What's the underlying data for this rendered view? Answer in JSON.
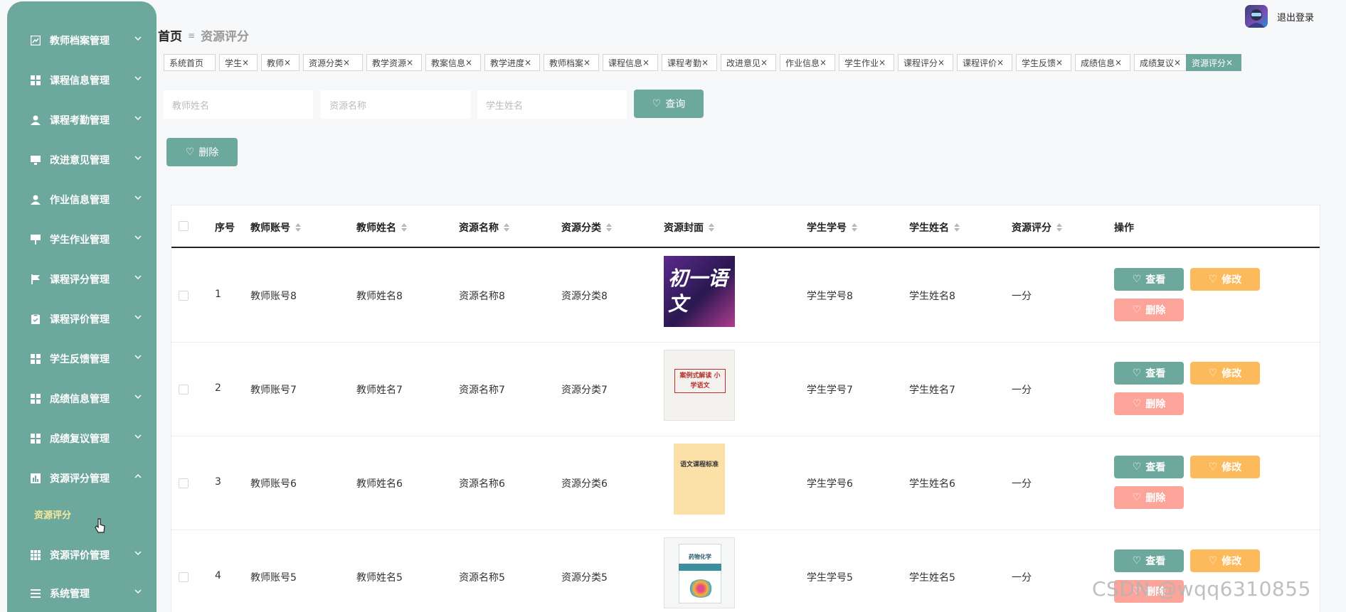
{
  "sidebar": {
    "items": [
      {
        "label": "教师档案管理",
        "icon": "chart-icon"
      },
      {
        "label": "课程信息管理",
        "icon": "grid-icon"
      },
      {
        "label": "课程考勤管理",
        "icon": "user-icon"
      },
      {
        "label": "改进意见管理",
        "icon": "monitor-icon"
      },
      {
        "label": "作业信息管理",
        "icon": "user-icon"
      },
      {
        "label": "学生作业管理",
        "icon": "board-icon"
      },
      {
        "label": "课程评分管理",
        "icon": "flag-icon"
      },
      {
        "label": "课程评价管理",
        "icon": "clipboard-icon"
      },
      {
        "label": "学生反馈管理",
        "icon": "grid-icon"
      },
      {
        "label": "成绩信息管理",
        "icon": "grid-icon"
      },
      {
        "label": "成绩复议管理",
        "icon": "grid-icon"
      },
      {
        "label": "资源评分管理",
        "icon": "bar-chart-icon",
        "expanded": true
      },
      {
        "label": "资源评价管理",
        "icon": "grid-icon"
      },
      {
        "label": "系统管理",
        "icon": "list-icon"
      }
    ],
    "sub_item": "资源评分"
  },
  "header": {
    "logout": "退出登录"
  },
  "breadcrumb": {
    "home": "首页",
    "separator": "≡",
    "current": "资源评分"
  },
  "tags": [
    {
      "label": "系统首页",
      "closable": false
    },
    {
      "label": "学生",
      "closable": true
    },
    {
      "label": "教师",
      "closable": true
    },
    {
      "label": "资源分类",
      "closable": true
    },
    {
      "label": "教学资源",
      "closable": true
    },
    {
      "label": "教案信息",
      "closable": true
    },
    {
      "label": "教学进度",
      "closable": true
    },
    {
      "label": "教师档案",
      "closable": true
    },
    {
      "label": "课程信息",
      "closable": true
    },
    {
      "label": "课程考勤",
      "closable": true
    },
    {
      "label": "改进意见",
      "closable": true
    },
    {
      "label": "作业信息",
      "closable": true
    },
    {
      "label": "学生作业",
      "closable": true
    },
    {
      "label": "课程评分",
      "closable": true
    },
    {
      "label": "课程评价",
      "closable": true
    },
    {
      "label": "学生反馈",
      "closable": true
    },
    {
      "label": "成绩信息",
      "closable": true
    },
    {
      "label": "成绩复议",
      "closable": true
    },
    {
      "label": "资源评分",
      "closable": true,
      "active": true
    }
  ],
  "search": {
    "teacher_name_placeholder": "教师姓名",
    "resource_name_placeholder": "资源名称",
    "student_name_placeholder": "学生姓名",
    "query_label": "查询"
  },
  "toolbar": {
    "delete_label": "删除"
  },
  "table": {
    "columns": [
      "序号",
      "教师账号",
      "教师姓名",
      "资源名称",
      "资源分类",
      "资源封面",
      "学生学号",
      "学生姓名",
      "资源评分",
      "操作"
    ],
    "actions": {
      "view": "查看",
      "edit": "修改",
      "delete": "删除"
    },
    "rows": [
      {
        "index": "1",
        "teacher_account": "教师账号8",
        "teacher_name": "教师姓名8",
        "resource_name": "资源名称8",
        "resource_category": "资源分类8",
        "cover_text": "初一语文",
        "student_id": "学生学号8",
        "student_name": "学生姓名8",
        "rating": "一分"
      },
      {
        "index": "2",
        "teacher_account": "教师账号7",
        "teacher_name": "教师姓名7",
        "resource_name": "资源名称7",
        "resource_category": "资源分类7",
        "cover_text": "案例式解读 小学语文",
        "student_id": "学生学号7",
        "student_name": "学生姓名7",
        "rating": "一分"
      },
      {
        "index": "3",
        "teacher_account": "教师账号6",
        "teacher_name": "教师姓名6",
        "resource_name": "资源名称6",
        "resource_category": "资源分类6",
        "cover_text": "语文课程标准",
        "student_id": "学生学号6",
        "student_name": "学生姓名6",
        "rating": "一分"
      },
      {
        "index": "4",
        "teacher_account": "教师账号5",
        "teacher_name": "教师姓名5",
        "resource_name": "资源名称5",
        "resource_category": "资源分类5",
        "cover_text": "药物化学",
        "student_id": "学生学号5",
        "student_name": "学生姓名5",
        "rating": "一分"
      }
    ]
  },
  "watermark": "CSDN @wqq6310855",
  "colors": {
    "primary": "#6da89c",
    "edit": "#fdba5d",
    "delete": "#fca49a",
    "sub_active": "#f6e89c"
  }
}
